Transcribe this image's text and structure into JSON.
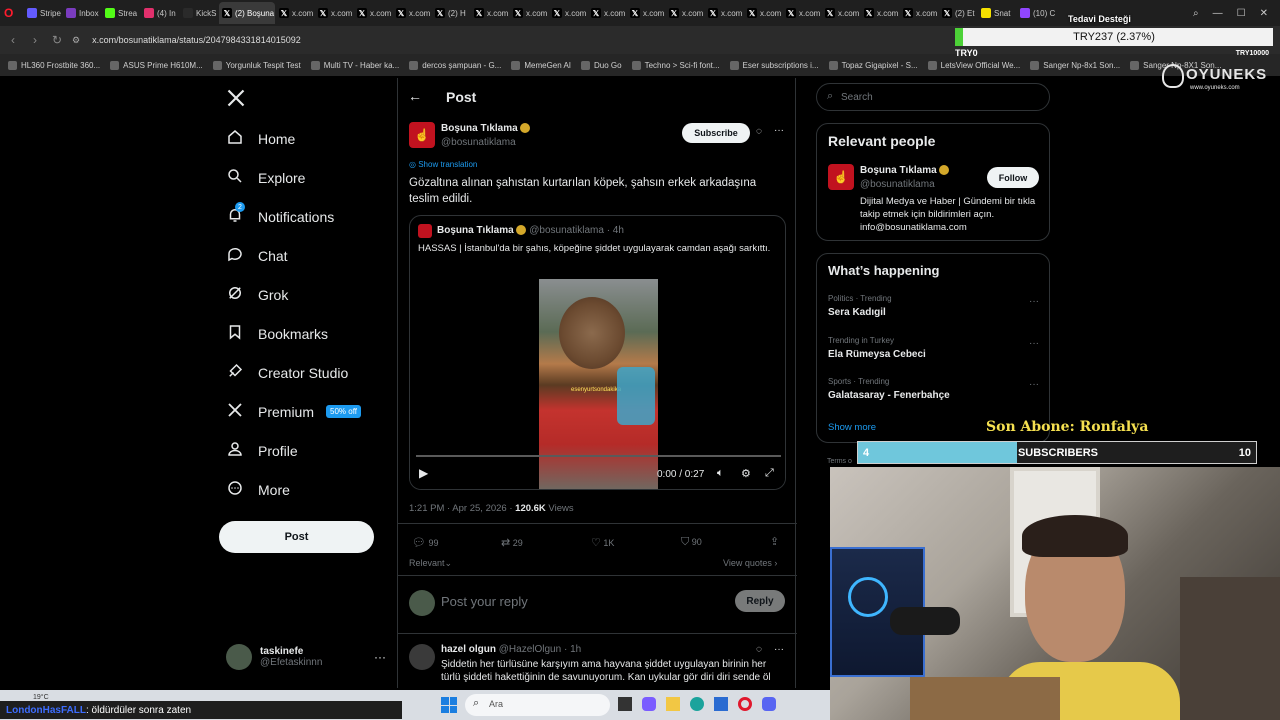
{
  "browser": {
    "tabs": [
      {
        "label": "Stripe",
        "color": "#635bff"
      },
      {
        "label": "Inbox",
        "color": "#7a3cbf"
      },
      {
        "label": "Strea",
        "color": "#53fc18"
      },
      {
        "label": "(4) In",
        "color": "#e1306c"
      },
      {
        "label": "KickS",
        "color": "#2a2a2a"
      },
      {
        "label": "(2) Boşuna",
        "color": "#000000"
      },
      {
        "label": "x.com",
        "color": "#000000"
      },
      {
        "label": "x.com",
        "color": "#000000"
      },
      {
        "label": "x.com",
        "color": "#000000"
      },
      {
        "label": "x.com",
        "color": "#000000"
      },
      {
        "label": "(2) H",
        "color": "#000000"
      },
      {
        "label": "x.com",
        "color": "#000000"
      },
      {
        "label": "x.com",
        "color": "#000000"
      },
      {
        "label": "x.com",
        "color": "#000000"
      },
      {
        "label": "x.com",
        "color": "#000000"
      },
      {
        "label": "x.com",
        "color": "#000000"
      },
      {
        "label": "x.com",
        "color": "#000000"
      },
      {
        "label": "x.com",
        "color": "#000000"
      },
      {
        "label": "x.com",
        "color": "#000000"
      },
      {
        "label": "x.com",
        "color": "#000000"
      },
      {
        "label": "x.com",
        "color": "#000000"
      },
      {
        "label": "x.com",
        "color": "#000000"
      },
      {
        "label": "x.com",
        "color": "#000000"
      },
      {
        "label": "(2) Et",
        "color": "#000000"
      },
      {
        "label": "Snat",
        "color": "#f5e100"
      },
      {
        "label": "(10) C",
        "color": "#9146ff"
      }
    ],
    "url": "x.com/bosunatiklama/status/2047984331814015092",
    "bookmarks": [
      "HL360 Frostbite 360...",
      "ASUS Prime H610M...",
      "Yorgunluk Tespit Test",
      "Multi TV - Haber ka...",
      "dercos şampuan - G...",
      "MemeGen AI",
      "Duo Go",
      "Techno > Sci-fi font...",
      "Eser subscriptions i...",
      "Topaz Gigapixel - S...",
      "LetsView Official We...",
      "Sanger Np-8x1 Son...",
      "Sanger Np-8X1 Son..."
    ]
  },
  "overlay": {
    "donation_title": "Tedavi Desteği",
    "donation_amount": "TRY237 (2.37%)",
    "donation_min": "TRY0",
    "donation_max": "TRY10000",
    "sponsor_brand": "OYUNEKS",
    "sponsor_url": "www.oyuneks.com",
    "last_sub": "Son Abone: Ronfalya",
    "sub_current": "4",
    "sub_label": "SUBSCRIBERS",
    "sub_goal": "10",
    "sub_progress": 0.4,
    "chat_user": "LondonHasFALL",
    "chat_msg": ": öldürdüler sonra zaten",
    "weather": "19°C",
    "search_label": "Ara"
  },
  "nav": {
    "items": [
      "Home",
      "Explore",
      "Notifications",
      "Chat",
      "Grok",
      "Bookmarks",
      "Creator Studio",
      "Premium",
      "Profile",
      "More"
    ],
    "notif_count": "2",
    "premium_badge": "50% off",
    "post_label": "Post",
    "account_name": "taskinefe",
    "account_handle": "@Efetaskinnn"
  },
  "post": {
    "header": "Post",
    "author": "Boşuna Tıklama",
    "handle": "@bosunatiklama",
    "subscribe": "Subscribe",
    "show_translation": "Show translation",
    "text": "Gözaltına alınan şahıstan kurtarılan köpek, şahsın erkek arkadaşına teslim edildi.",
    "quote_author": "Boşuna Tıklama",
    "quote_handle": "@bosunatiklama",
    "quote_time": "· 4h",
    "quote_text": "HASSAS | İstanbul'da bir şahıs, köpeğine şiddet uygulayarak camdan aşağı sarkıttı.",
    "video_time": "0:00 / 0:27",
    "video_watermark": "esenyurtsondakika",
    "video_progress": 0,
    "timestamp": "1:21 PM · Apr 25, 2026 · ",
    "views_count": "120.6K",
    "views_label": " Views",
    "replies": "99",
    "reposts": "29",
    "likes": "1K",
    "bookmarks": "90",
    "sort": "Relevant",
    "view_quotes": "View quotes",
    "reply_placeholder": "Post your reply",
    "reply_button": "Reply"
  },
  "reply": {
    "author": "hazel olgun",
    "handle": "@HazelOlgun",
    "time": "· 1h",
    "text": "Şiddetin her türlüsüne karşıyım ama hayvana şiddet uygulayan birinin her türlü şiddeti hakettiğinin de savunuyorum. Kan uykular gör diri diri sende öl"
  },
  "sidebar": {
    "search_placeholder": "Search",
    "relevant_title": "Relevant people",
    "person_name": "Boşuna Tıklama",
    "person_handle": "@bosunatiklama",
    "follow": "Follow",
    "person_bio": "Dijital Medya ve Haber | Gündemi bir tıkla takip etmek için bildirimleri açın. info@bosunatiklama.com",
    "happening_title": "What’s happening",
    "trends": [
      {
        "cat": "Politics · Trending",
        "name": "Sera Kadıgil"
      },
      {
        "cat": "Trending in Turkey",
        "name": "Ela Rümeysa Cebeci"
      },
      {
        "cat": "Sports · Trending",
        "name": "Galatasaray - Fenerbahçe"
      }
    ],
    "show_more": "Show more",
    "terms": "Terms o"
  }
}
